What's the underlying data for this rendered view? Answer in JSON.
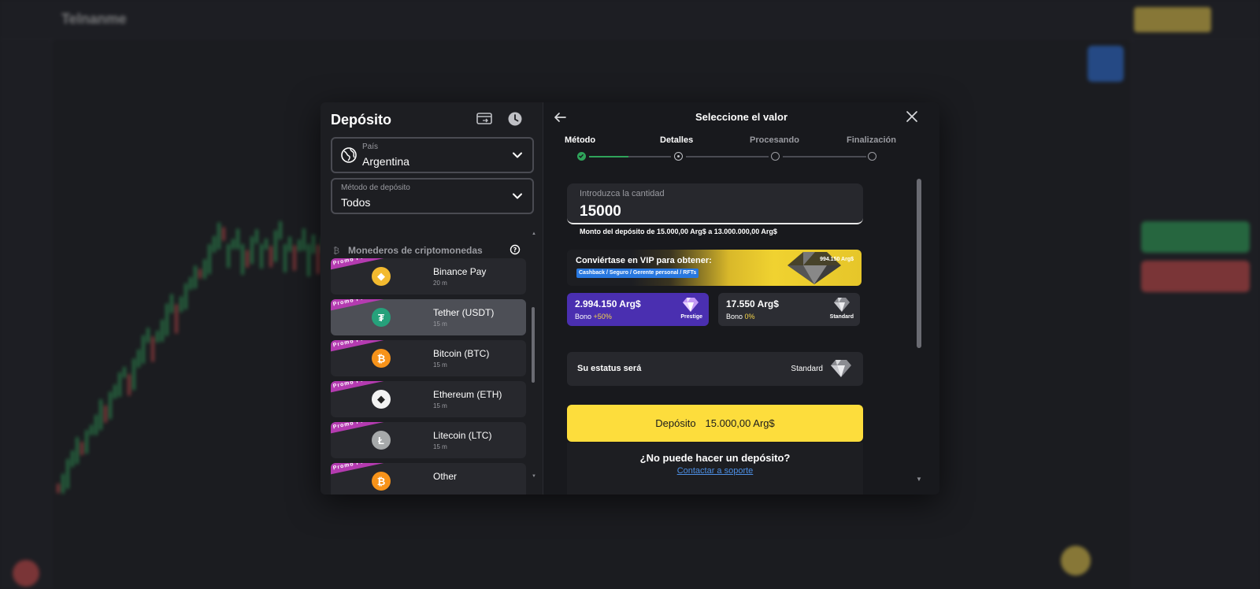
{
  "background": {
    "logo": "Telnanme"
  },
  "deposit_panel": {
    "title": "Depósito",
    "transfer_icon": "transfer-icon",
    "history_icon": "clock-icon",
    "country": {
      "label": "País",
      "value": "Argentina",
      "icon": "globe-icon"
    },
    "method": {
      "label": "Método de depósito",
      "value": "Todos"
    },
    "section_title": "Monederos de criptomonedas",
    "promo_text": "Promo Promo Promo Promo",
    "methods": [
      {
        "name": "Binance Pay",
        "time": "20 m",
        "coin": "binance-icon",
        "color": "#f3ba2f",
        "glyph": "◆"
      },
      {
        "name": "Tether (USDT)",
        "time": "15 m",
        "coin": "tether-icon",
        "color": "#26a17b",
        "glyph": "₮"
      },
      {
        "name": "Bitcoin (BTC)",
        "time": "15 m",
        "coin": "bitcoin-icon",
        "color": "#f7931a",
        "glyph": "₿"
      },
      {
        "name": "Ethereum (ETH)",
        "time": "15 m",
        "coin": "ethereum-icon",
        "color": "#f2f2f2",
        "glyph": "◆"
      },
      {
        "name": "Litecoin (LTC)",
        "time": "15 m",
        "coin": "litecoin-icon",
        "color": "#a6a9aa",
        "glyph": "Ł"
      },
      {
        "name": "Other",
        "time": "",
        "coin": "other-coin-icon",
        "color": "#f7931a",
        "glyph": "₿"
      }
    ]
  },
  "value_panel": {
    "title": "Seleccione el valor",
    "steps": [
      {
        "label": "Método",
        "state": "done"
      },
      {
        "label": "Detalles",
        "state": "current"
      },
      {
        "label": "Procesando",
        "state": "pending"
      },
      {
        "label": "Finalización",
        "state": "pending"
      }
    ],
    "amount": {
      "label": "Introduzca la cantidad",
      "value": "15000"
    },
    "amount_hint": "Monto del depósito de 15.000,00 Arg$ a 13.000.000,00 Arg$",
    "vip": {
      "title": "Conviértase en VIP para obtener:",
      "tag": "Cashback / Seguro / Gerente personal / RFTs",
      "amount": "994.150 Arg$"
    },
    "tiers": [
      {
        "amount": "2.994.150 Arg$",
        "bonus_label": "Bono",
        "bonus_value": "+50%",
        "name": "Prestige",
        "bg": "#4a2fb0",
        "bonus_color": "#f7d64a"
      },
      {
        "amount": "17.550 Arg$",
        "bonus_label": "Bono",
        "bonus_value": "0%",
        "name": "Standard",
        "bg": "#2c2d33",
        "bonus_color": "#f7d64a"
      }
    ],
    "status": {
      "label": "Su estatus será",
      "value": "Standard"
    },
    "deposit_button": {
      "label": "Depósito",
      "amount": "15.000,00 Arg$"
    },
    "help": {
      "title": "¿No puede hacer un depósito?",
      "link": "Contactar a soporte"
    }
  }
}
